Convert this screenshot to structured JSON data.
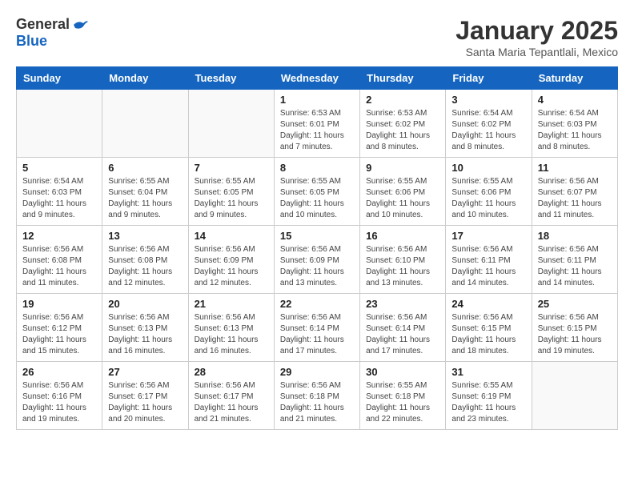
{
  "logo": {
    "general": "General",
    "blue": "Blue"
  },
  "header": {
    "month": "January 2025",
    "location": "Santa Maria Tepantlali, Mexico"
  },
  "weekdays": [
    "Sunday",
    "Monday",
    "Tuesday",
    "Wednesday",
    "Thursday",
    "Friday",
    "Saturday"
  ],
  "weeks": [
    [
      {
        "day": "",
        "info": ""
      },
      {
        "day": "",
        "info": ""
      },
      {
        "day": "",
        "info": ""
      },
      {
        "day": "1",
        "info": "Sunrise: 6:53 AM\nSunset: 6:01 PM\nDaylight: 11 hours\nand 7 minutes."
      },
      {
        "day": "2",
        "info": "Sunrise: 6:53 AM\nSunset: 6:02 PM\nDaylight: 11 hours\nand 8 minutes."
      },
      {
        "day": "3",
        "info": "Sunrise: 6:54 AM\nSunset: 6:02 PM\nDaylight: 11 hours\nand 8 minutes."
      },
      {
        "day": "4",
        "info": "Sunrise: 6:54 AM\nSunset: 6:03 PM\nDaylight: 11 hours\nand 8 minutes."
      }
    ],
    [
      {
        "day": "5",
        "info": "Sunrise: 6:54 AM\nSunset: 6:03 PM\nDaylight: 11 hours\nand 9 minutes."
      },
      {
        "day": "6",
        "info": "Sunrise: 6:55 AM\nSunset: 6:04 PM\nDaylight: 11 hours\nand 9 minutes."
      },
      {
        "day": "7",
        "info": "Sunrise: 6:55 AM\nSunset: 6:05 PM\nDaylight: 11 hours\nand 9 minutes."
      },
      {
        "day": "8",
        "info": "Sunrise: 6:55 AM\nSunset: 6:05 PM\nDaylight: 11 hours\nand 10 minutes."
      },
      {
        "day": "9",
        "info": "Sunrise: 6:55 AM\nSunset: 6:06 PM\nDaylight: 11 hours\nand 10 minutes."
      },
      {
        "day": "10",
        "info": "Sunrise: 6:55 AM\nSunset: 6:06 PM\nDaylight: 11 hours\nand 10 minutes."
      },
      {
        "day": "11",
        "info": "Sunrise: 6:56 AM\nSunset: 6:07 PM\nDaylight: 11 hours\nand 11 minutes."
      }
    ],
    [
      {
        "day": "12",
        "info": "Sunrise: 6:56 AM\nSunset: 6:08 PM\nDaylight: 11 hours\nand 11 minutes."
      },
      {
        "day": "13",
        "info": "Sunrise: 6:56 AM\nSunset: 6:08 PM\nDaylight: 11 hours\nand 12 minutes."
      },
      {
        "day": "14",
        "info": "Sunrise: 6:56 AM\nSunset: 6:09 PM\nDaylight: 11 hours\nand 12 minutes."
      },
      {
        "day": "15",
        "info": "Sunrise: 6:56 AM\nSunset: 6:09 PM\nDaylight: 11 hours\nand 13 minutes."
      },
      {
        "day": "16",
        "info": "Sunrise: 6:56 AM\nSunset: 6:10 PM\nDaylight: 11 hours\nand 13 minutes."
      },
      {
        "day": "17",
        "info": "Sunrise: 6:56 AM\nSunset: 6:11 PM\nDaylight: 11 hours\nand 14 minutes."
      },
      {
        "day": "18",
        "info": "Sunrise: 6:56 AM\nSunset: 6:11 PM\nDaylight: 11 hours\nand 14 minutes."
      }
    ],
    [
      {
        "day": "19",
        "info": "Sunrise: 6:56 AM\nSunset: 6:12 PM\nDaylight: 11 hours\nand 15 minutes."
      },
      {
        "day": "20",
        "info": "Sunrise: 6:56 AM\nSunset: 6:13 PM\nDaylight: 11 hours\nand 16 minutes."
      },
      {
        "day": "21",
        "info": "Sunrise: 6:56 AM\nSunset: 6:13 PM\nDaylight: 11 hours\nand 16 minutes."
      },
      {
        "day": "22",
        "info": "Sunrise: 6:56 AM\nSunset: 6:14 PM\nDaylight: 11 hours\nand 17 minutes."
      },
      {
        "day": "23",
        "info": "Sunrise: 6:56 AM\nSunset: 6:14 PM\nDaylight: 11 hours\nand 17 minutes."
      },
      {
        "day": "24",
        "info": "Sunrise: 6:56 AM\nSunset: 6:15 PM\nDaylight: 11 hours\nand 18 minutes."
      },
      {
        "day": "25",
        "info": "Sunrise: 6:56 AM\nSunset: 6:15 PM\nDaylight: 11 hours\nand 19 minutes."
      }
    ],
    [
      {
        "day": "26",
        "info": "Sunrise: 6:56 AM\nSunset: 6:16 PM\nDaylight: 11 hours\nand 19 minutes."
      },
      {
        "day": "27",
        "info": "Sunrise: 6:56 AM\nSunset: 6:17 PM\nDaylight: 11 hours\nand 20 minutes."
      },
      {
        "day": "28",
        "info": "Sunrise: 6:56 AM\nSunset: 6:17 PM\nDaylight: 11 hours\nand 21 minutes."
      },
      {
        "day": "29",
        "info": "Sunrise: 6:56 AM\nSunset: 6:18 PM\nDaylight: 11 hours\nand 21 minutes."
      },
      {
        "day": "30",
        "info": "Sunrise: 6:55 AM\nSunset: 6:18 PM\nDaylight: 11 hours\nand 22 minutes."
      },
      {
        "day": "31",
        "info": "Sunrise: 6:55 AM\nSunset: 6:19 PM\nDaylight: 11 hours\nand 23 minutes."
      },
      {
        "day": "",
        "info": ""
      }
    ]
  ]
}
